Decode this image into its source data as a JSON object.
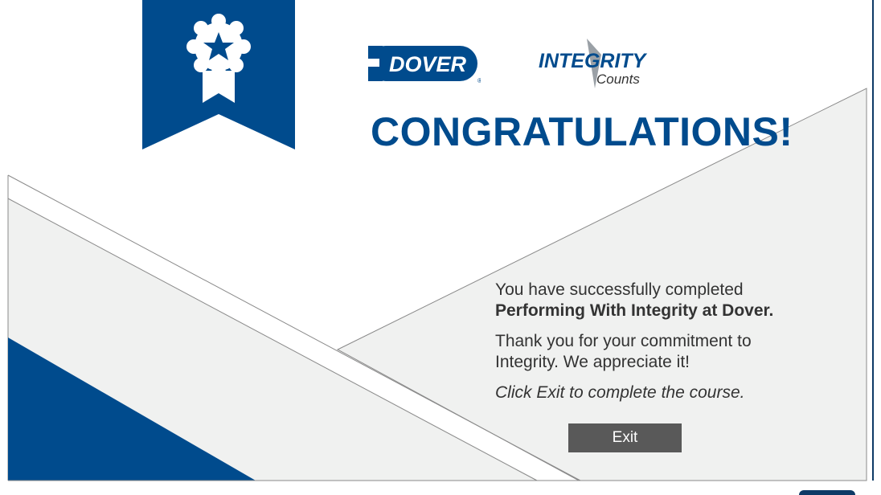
{
  "logos": {
    "dover_text": "DOVER",
    "integrity_text": "INTEGRITY",
    "counts_text": "Counts"
  },
  "heading": "CONGRATULATIONS!",
  "message": {
    "line1": "You have successfully completed",
    "course_name": "Performing With Integrity at Dover.",
    "thanks_line1": "Thank you for your commitment to",
    "thanks_line2": "Integrity. We appreciate it!",
    "instruction": "Click Exit to complete the course."
  },
  "exit_button": {
    "label": "Exit"
  },
  "colors": {
    "brand_blue": "#004b8d",
    "panel_gray": "#f0f1f0",
    "button_gray": "#595959"
  },
  "icons": [
    "award-ribbon-icon",
    "star-icon"
  ]
}
